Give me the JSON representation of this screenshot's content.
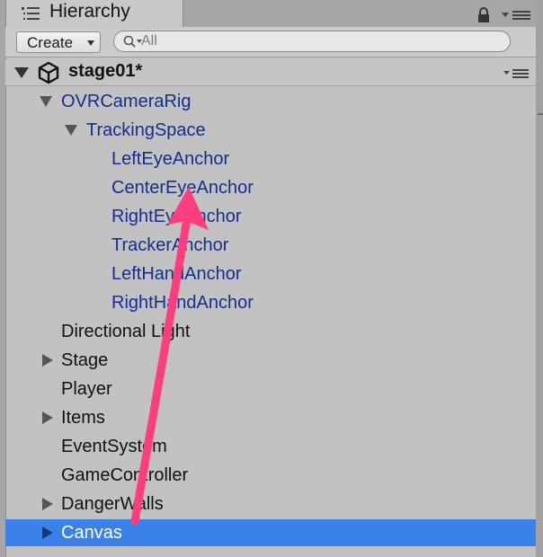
{
  "window": {
    "tab_title": "Hierarchy",
    "icons": {
      "tab": "list-icon",
      "lock": "lock-icon",
      "menu": "menu-icon"
    }
  },
  "toolbar": {
    "create_label": "Create",
    "search_placeholder": "All",
    "search_value": ""
  },
  "scene": {
    "name": "stage01*",
    "expanded": true,
    "icon": "unity-icon"
  },
  "tree": {
    "items": [
      {
        "label": "OVRCameraRig",
        "depth": 1,
        "expander": "expanded",
        "prefab": true,
        "selected": false
      },
      {
        "label": "TrackingSpace",
        "depth": 2,
        "expander": "expanded",
        "prefab": true,
        "selected": false
      },
      {
        "label": "LeftEyeAnchor",
        "depth": 3,
        "expander": "none",
        "prefab": true,
        "selected": false
      },
      {
        "label": "CenterEyeAnchor",
        "depth": 3,
        "expander": "none",
        "prefab": true,
        "selected": false
      },
      {
        "label": "RightEyeAnchor",
        "depth": 3,
        "expander": "none",
        "prefab": true,
        "selected": false
      },
      {
        "label": "TrackerAnchor",
        "depth": 3,
        "expander": "none",
        "prefab": true,
        "selected": false
      },
      {
        "label": "LeftHandAnchor",
        "depth": 3,
        "expander": "none",
        "prefab": true,
        "selected": false
      },
      {
        "label": "RightHandAnchor",
        "depth": 3,
        "expander": "none",
        "prefab": true,
        "selected": false
      },
      {
        "label": "Directional Light",
        "depth": 1,
        "expander": "none",
        "prefab": false,
        "selected": false
      },
      {
        "label": "Stage",
        "depth": 1,
        "expander": "collapsed",
        "prefab": false,
        "selected": false
      },
      {
        "label": "Player",
        "depth": 1,
        "expander": "none",
        "prefab": false,
        "selected": false
      },
      {
        "label": "Items",
        "depth": 1,
        "expander": "collapsed",
        "prefab": false,
        "selected": false
      },
      {
        "label": "EventSystem",
        "depth": 1,
        "expander": "none",
        "prefab": false,
        "selected": false
      },
      {
        "label": "GameController",
        "depth": 1,
        "expander": "none",
        "prefab": false,
        "selected": false
      },
      {
        "label": "DangerWalls",
        "depth": 1,
        "expander": "collapsed",
        "prefab": false,
        "selected": false
      },
      {
        "label": "Canvas",
        "depth": 1,
        "expander": "collapsed",
        "prefab": false,
        "selected": true
      }
    ]
  },
  "colors": {
    "prefab_text": "#142f8c",
    "selection": "#3a82e9",
    "annotation_arrow": "#ff3d7f"
  },
  "annotation": {
    "type": "arrow",
    "from_item": "Canvas",
    "to_item": "CenterEyeAnchor"
  }
}
